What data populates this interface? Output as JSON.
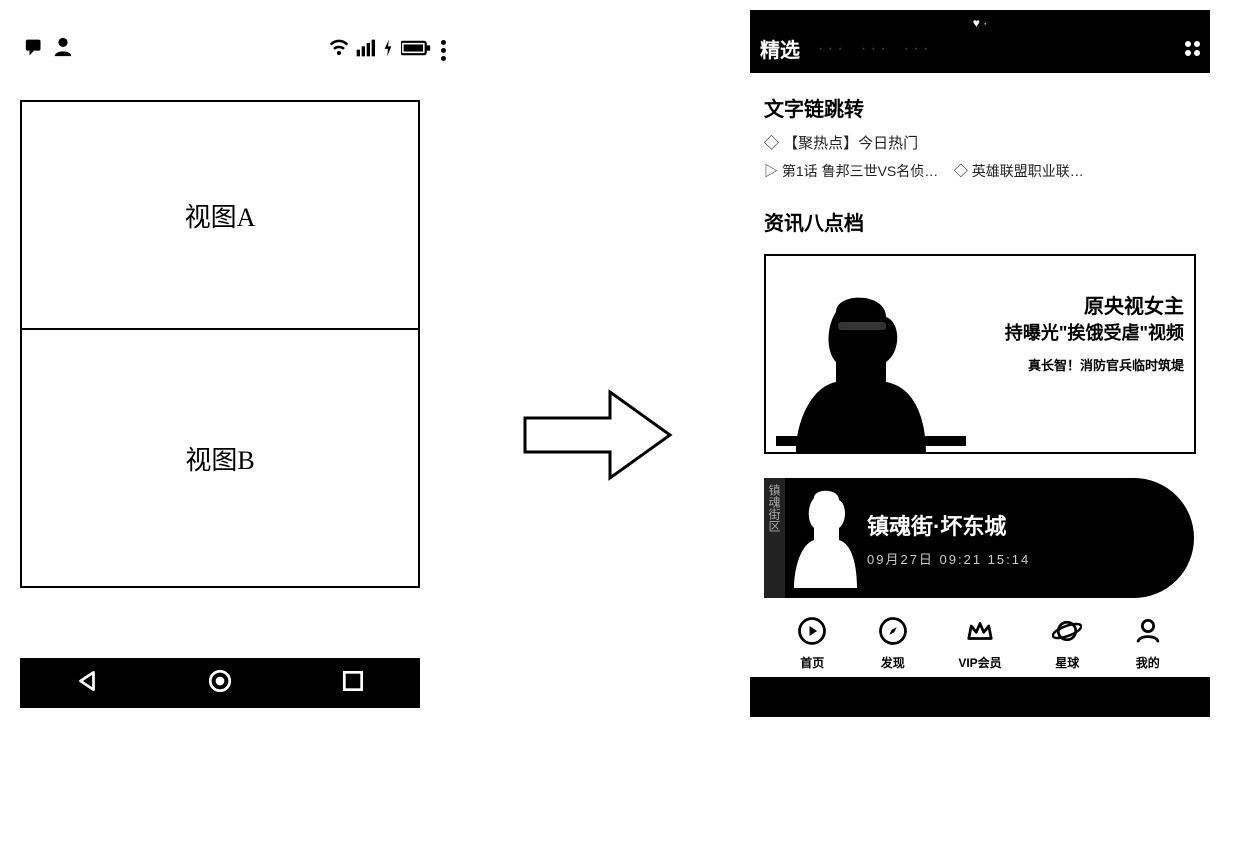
{
  "left_phone": {
    "status": {
      "msg_icon": "message-icon",
      "user_icon": "user-icon",
      "wifi_icon": "wifi-icon",
      "signal_icon": "signal-icon",
      "charge_icon": "charge-icon",
      "battery_icon": "battery-icon",
      "more_icon": "more-vertical-icon"
    },
    "view_a_label": "视图A",
    "view_b_label": "视图B",
    "nav": {
      "back_icon": "triangle-back-icon",
      "home_icon": "circle-home-icon",
      "recent_icon": "square-recent-icon"
    }
  },
  "arrow": {
    "name": "right-arrow"
  },
  "right_phone": {
    "header": {
      "heart_icon": "heart-icon",
      "active_tab": "精选",
      "grid_icon": "apps-grid-icon"
    },
    "section_links_title": "文字链跳转",
    "link1": "【聚热点】今日热门",
    "link2a": "第1话 鲁邦三世VS名侦…",
    "link2b": "英雄联盟职业联…",
    "section_news_title": "资讯八点档",
    "card": {
      "badge": "",
      "line1": "原央视女主",
      "line2": "持曝光\"挨饿受虐\"视频",
      "sub": "真长智！消防官兵临时筑堤",
      "meta": ""
    },
    "banner": {
      "side_label": "镇魂街区",
      "title": "镇魂街·坏东城",
      "sub": "09月27日   09:21   15:14"
    },
    "bottom_tabs": [
      {
        "icon": "play-circle-icon",
        "label": "首页"
      },
      {
        "icon": "compass-icon",
        "label": "发现"
      },
      {
        "icon": "crown-icon",
        "label": "VIP会员"
      },
      {
        "icon": "planet-icon",
        "label": "星球"
      },
      {
        "icon": "person-icon",
        "label": "我的"
      }
    ]
  }
}
